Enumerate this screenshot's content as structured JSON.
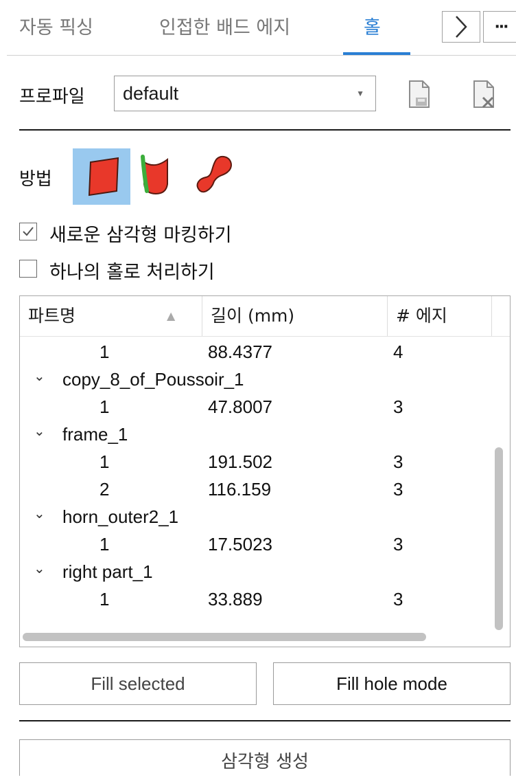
{
  "tabs": [
    {
      "label": "자동 픽싱"
    },
    {
      "label": "인접한 배드 에지"
    },
    {
      "label": "홀",
      "active": true
    }
  ],
  "tab_controls": {
    "next_glyph": ">",
    "more_glyph": "···"
  },
  "colors": {
    "accent": "#2a7fd4",
    "method_selected_bg": "#99c9ef",
    "shape_red": "#e8382a",
    "shape_green": "#3cae3c"
  },
  "profile": {
    "label": "프로파일",
    "value": "default",
    "icons": [
      "new-profile-icon",
      "delete-profile-icon"
    ]
  },
  "method": {
    "label": "방법",
    "options": [
      "planar-fill-icon",
      "freeform-fill-icon",
      "ribbon-fill-icon"
    ],
    "selected": 0
  },
  "options": {
    "mark_triangles": {
      "label": "새로운 삼각형 마킹하기",
      "checked": true
    },
    "treat_as_one": {
      "label": "하나의 홀로 처리하기",
      "checked": false
    }
  },
  "table": {
    "columns": [
      "파트명",
      "길이 (mm)",
      "# 에지"
    ],
    "rows": [
      {
        "type": "hole",
        "id": "1",
        "length": "88.4377",
        "edges": "4"
      },
      {
        "type": "part",
        "name": "copy_8_of_Poussoir_1"
      },
      {
        "type": "hole",
        "id": "1",
        "length": "47.8007",
        "edges": "3"
      },
      {
        "type": "part",
        "name": "frame_1"
      },
      {
        "type": "hole",
        "id": "1",
        "length": "191.502",
        "edges": "3"
      },
      {
        "type": "hole",
        "id": "2",
        "length": "116.159",
        "edges": "3"
      },
      {
        "type": "part",
        "name": "horn_outer2_1"
      },
      {
        "type": "hole",
        "id": "1",
        "length": "17.5023",
        "edges": "3"
      },
      {
        "type": "part",
        "name": "right part_1"
      },
      {
        "type": "hole",
        "id": "1",
        "length": "33.889",
        "edges": "3"
      }
    ]
  },
  "buttons": {
    "fill_selected": "Fill selected",
    "fill_hole_mode": "Fill hole mode",
    "create_triangles": "삼각형 생성"
  }
}
